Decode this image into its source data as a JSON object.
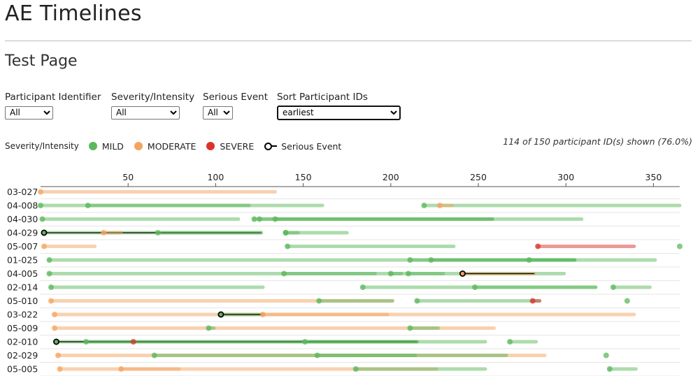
{
  "page": {
    "title": "AE Timelines",
    "subtitle": "Test Page"
  },
  "filters": [
    {
      "label": "Participant Identifier",
      "value": "All"
    },
    {
      "label": "Severity/Intensity",
      "value": "All"
    },
    {
      "label": "Serious Event",
      "value": "All"
    },
    {
      "label": "Sort Participant IDs",
      "value": "earliest"
    }
  ],
  "legend": {
    "title": "Severity/Intensity",
    "items": [
      {
        "label": "MILD",
        "color": "#5cb85c"
      },
      {
        "label": "MODERATE",
        "color": "#f4a460"
      },
      {
        "label": "SEVERE",
        "color": "#d9342b"
      }
    ],
    "serious_label": "Serious Event"
  },
  "shown_text": "114 of 150 participant ID(s) shown (76.0%)",
  "colors": {
    "MILD": "#5cb85c",
    "MODERATE": "#f4a460",
    "SEVERE": "#d9342b",
    "serious": "#000000"
  },
  "chart_data": {
    "type": "timeline",
    "xlim": [
      0,
      365
    ],
    "x_ticks": [
      50,
      100,
      150,
      200,
      250,
      300,
      350
    ],
    "grid": true,
    "participants": [
      {
        "id": "03-027",
        "events": [
          {
            "start": 0,
            "end": 134,
            "severity": "MODERATE"
          }
        ]
      },
      {
        "id": "04-008",
        "events": [
          {
            "start": 0,
            "end": 161,
            "severity": "MILD"
          },
          {
            "start": 27,
            "end": 119,
            "severity": "MILD"
          },
          {
            "start": 219,
            "end": 365,
            "severity": "MILD"
          },
          {
            "start": 228,
            "end": 235,
            "severity": "MODERATE"
          }
        ]
      },
      {
        "id": "04-030",
        "events": [
          {
            "start": 1,
            "end": 113,
            "severity": "MILD"
          },
          {
            "start": 122,
            "end": 309,
            "severity": "MILD"
          },
          {
            "start": 125,
            "end": 258,
            "severity": "MILD"
          },
          {
            "start": 134,
            "end": 258,
            "severity": "MILD"
          }
        ]
      },
      {
        "id": "04-029",
        "events": [
          {
            "start": 2,
            "end": 126,
            "severity": "MILD",
            "serious": true
          },
          {
            "start": 36,
            "end": 46,
            "severity": "MODERATE"
          },
          {
            "start": 67,
            "end": 126,
            "severity": "MILD"
          },
          {
            "start": 140,
            "end": 147,
            "severity": "MILD"
          },
          {
            "start": 140,
            "end": 175,
            "severity": "MILD"
          }
        ]
      },
      {
        "id": "05-007",
        "events": [
          {
            "start": 2,
            "end": 31,
            "severity": "MODERATE"
          },
          {
            "start": 141,
            "end": 236,
            "severity": "MILD"
          },
          {
            "start": 284,
            "end": 339,
            "severity": "SEVERE"
          },
          {
            "start": 365,
            "end": 365,
            "severity": "MILD"
          }
        ]
      },
      {
        "id": "01-025",
        "events": [
          {
            "start": 5,
            "end": 351,
            "severity": "MILD"
          },
          {
            "start": 211,
            "end": 305,
            "severity": "MILD"
          },
          {
            "start": 223,
            "end": 305,
            "severity": "MILD"
          },
          {
            "start": 279,
            "end": 305,
            "severity": "MILD"
          }
        ]
      },
      {
        "id": "04-005",
        "events": [
          {
            "start": 5,
            "end": 299,
            "severity": "MILD"
          },
          {
            "start": 139,
            "end": 191,
            "severity": "MILD"
          },
          {
            "start": 200,
            "end": 206,
            "severity": "MILD"
          },
          {
            "start": 210,
            "end": 230,
            "severity": "MILD"
          },
          {
            "start": 241,
            "end": 282,
            "severity": "MODERATE",
            "serious": true
          }
        ]
      },
      {
        "id": "02-014",
        "events": [
          {
            "start": 6,
            "end": 127,
            "severity": "MILD"
          },
          {
            "start": 184,
            "end": 317,
            "severity": "MILD"
          },
          {
            "start": 248,
            "end": 317,
            "severity": "MILD"
          },
          {
            "start": 327,
            "end": 348,
            "severity": "MILD"
          }
        ]
      },
      {
        "id": "05-010",
        "events": [
          {
            "start": 6,
            "end": 201,
            "severity": "MODERATE"
          },
          {
            "start": 159,
            "end": 201,
            "severity": "MILD"
          },
          {
            "start": 215,
            "end": 285,
            "severity": "MILD"
          },
          {
            "start": 281,
            "end": 285,
            "severity": "SEVERE"
          },
          {
            "start": 335,
            "end": 335,
            "severity": "MILD"
          }
        ]
      },
      {
        "id": "03-022",
        "events": [
          {
            "start": 8,
            "end": 339,
            "severity": "MODERATE"
          },
          {
            "start": 103,
            "end": 127,
            "severity": "MILD",
            "serious": true
          },
          {
            "start": 127,
            "end": 198,
            "severity": "MODERATE"
          }
        ]
      },
      {
        "id": "05-009",
        "events": [
          {
            "start": 8,
            "end": 259,
            "severity": "MODERATE"
          },
          {
            "start": 96,
            "end": 99,
            "severity": "MILD"
          },
          {
            "start": 211,
            "end": 227,
            "severity": "MILD"
          }
        ]
      },
      {
        "id": "02-010",
        "events": [
          {
            "start": 9,
            "end": 215,
            "severity": "MILD",
            "serious": true
          },
          {
            "start": 26,
            "end": 254,
            "severity": "MILD"
          },
          {
            "start": 53,
            "end": 53,
            "severity": "SEVERE"
          },
          {
            "start": 151,
            "end": 215,
            "severity": "MILD"
          },
          {
            "start": 268,
            "end": 283,
            "severity": "MILD"
          }
        ]
      },
      {
        "id": "02-029",
        "events": [
          {
            "start": 10,
            "end": 288,
            "severity": "MODERATE"
          },
          {
            "start": 65,
            "end": 266,
            "severity": "MILD"
          },
          {
            "start": 158,
            "end": 214,
            "severity": "MILD"
          },
          {
            "start": 323,
            "end": 323,
            "severity": "MILD"
          }
        ]
      },
      {
        "id": "05-005",
        "events": [
          {
            "start": 11,
            "end": 226,
            "severity": "MODERATE"
          },
          {
            "start": 46,
            "end": 79,
            "severity": "MODERATE"
          },
          {
            "start": 180,
            "end": 254,
            "severity": "MILD"
          },
          {
            "start": 325,
            "end": 340,
            "severity": "MILD"
          }
        ]
      }
    ]
  }
}
